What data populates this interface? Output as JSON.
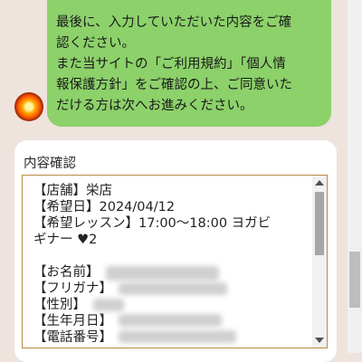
{
  "message": {
    "lines": [
      "最後に、入力していただいた内容をご確",
      "認ください。",
      "また当サイトの「ご利用規約」「個人情",
      "報保護方針」をご確認の上、ご同意いた",
      "だける方は次へお進みください。"
    ]
  },
  "confirm": {
    "title": "内容確認",
    "lines": [
      "【店舗】栄店",
      "【希望日】2024/04/12",
      "【希望レッスン】17:00〜18:00 ヨガビ",
      "ギナー ♥2",
      "",
      "【お名前】",
      "【フリガナ】",
      "【性別】",
      "【生年月日】",
      "【電話番号】"
    ]
  }
}
